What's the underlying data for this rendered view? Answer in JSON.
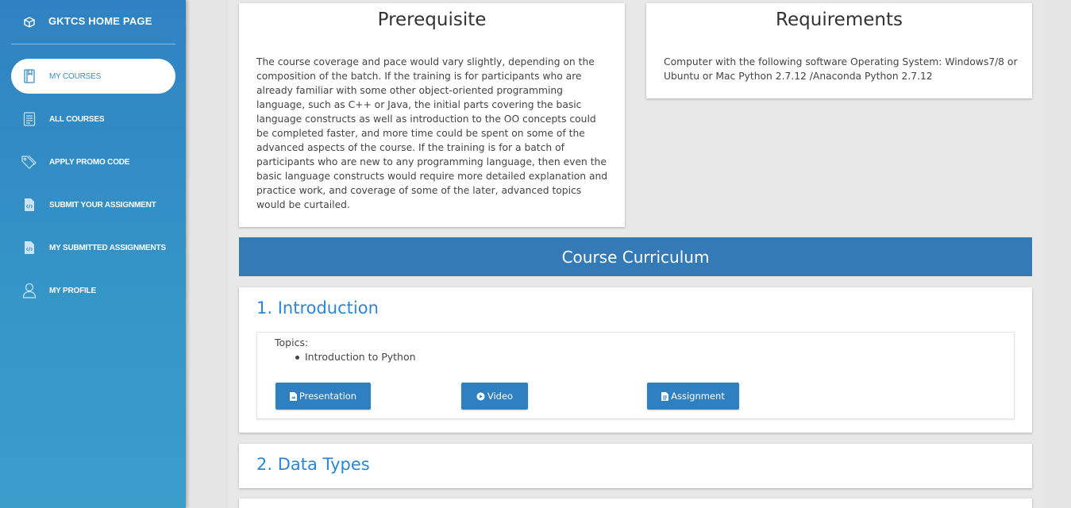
{
  "sidebar": {
    "brand": {
      "label": "GKTCS HOME PAGE",
      "icon": "cube-icon"
    },
    "items": [
      {
        "label": "MY COURSES",
        "icon": "book-icon",
        "active": true
      },
      {
        "label": "ALL COURSES",
        "icon": "document-list-icon",
        "active": false
      },
      {
        "label": "APPLY PROMO CODE",
        "icon": "tag-icon",
        "active": false
      },
      {
        "label": "SUBMIT YOUR ASSIGNMENT",
        "icon": "code-file-icon",
        "active": false
      },
      {
        "label": "MY SUBMITTED ASSIGNMENTS",
        "icon": "code-file-icon",
        "active": false
      },
      {
        "label": "MY PROFILE",
        "icon": "user-icon",
        "active": false
      }
    ]
  },
  "prerequisite": {
    "title": "Prerequisite",
    "text": "The course coverage and pace would vary slightly, depending on the composition of the batch. If the training is for participants who are already familiar with some other object-oriented programming language, such as C++ or Java, the initial parts covering the basic language constructs as well as introduction to the OO concepts could be completed faster, and more time could be spent on some of the advanced aspects of the course. If the training is for a batch of participants who are new to any programming language, then even the basic language constructs would require more detailed explanation and practice work, and coverage of some of the later, advanced topics would be curtailed."
  },
  "requirements": {
    "title": "Requirements",
    "text": "Computer with the following software Operating System: Windows7/8 or Ubuntu or Mac Python 2.7.12 /Anaconda Python 2.7.12"
  },
  "curriculum": {
    "title": "Course Curriculum",
    "modules": [
      {
        "title": "1. Introduction",
        "topics_label": "Topics:",
        "topics": [
          "Introduction to Python"
        ],
        "buttons": [
          {
            "label": "Presentation",
            "icon": "file-image-icon"
          },
          {
            "label": "Video",
            "icon": "play-circle-icon"
          },
          {
            "label": "Assignment",
            "icon": "file-text-icon"
          }
        ]
      },
      {
        "title": "2. Data Types"
      }
    ]
  },
  "colors": {
    "sidebar": "#2f82c1",
    "accent": "#337ab7",
    "link": "#2a86d8",
    "button": "#2f80c0"
  }
}
